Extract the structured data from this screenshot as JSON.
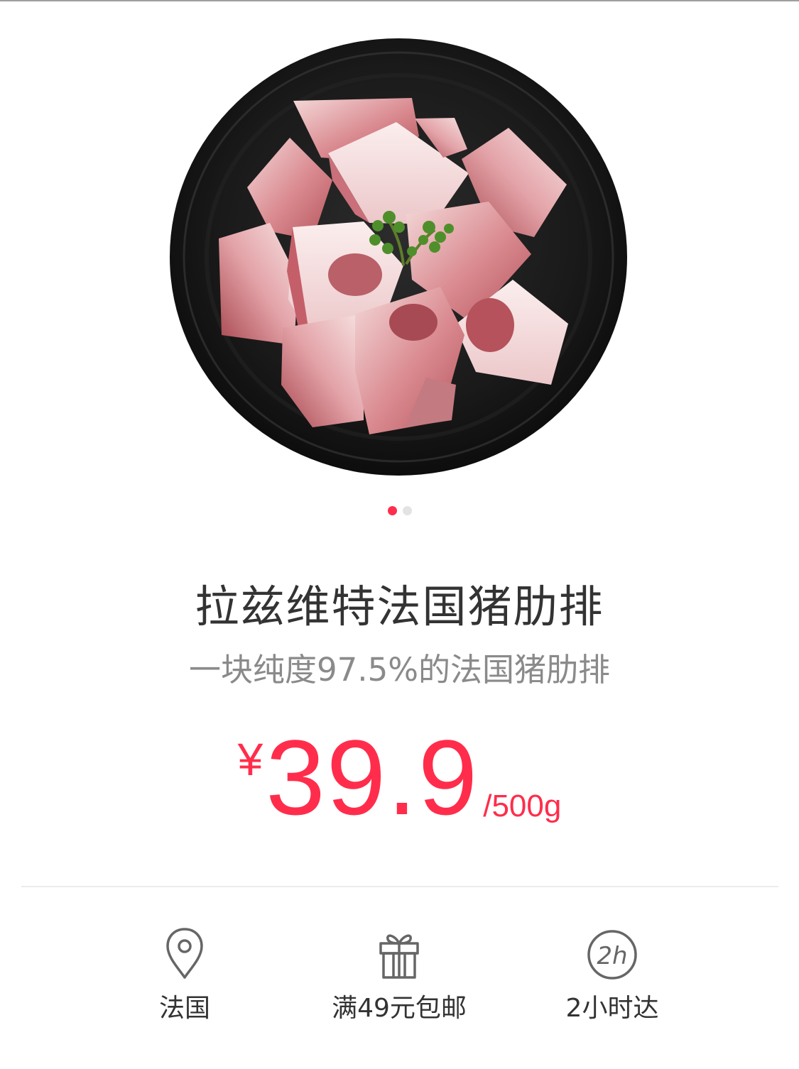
{
  "product": {
    "image_alt": "pork-ribs-on-black-plate",
    "title": "拉兹维特法国猪肋排",
    "subtitle": "一块纯度97.5%的法国猪肋排",
    "price": {
      "currency": "¥",
      "amount": "39.9",
      "unit": "/500g"
    }
  },
  "carousel": {
    "total": 2,
    "active_index": 0
  },
  "features": [
    {
      "icon": "location-pin-icon",
      "label": "法国"
    },
    {
      "icon": "gift-icon",
      "label": "满49元包邮"
    },
    {
      "icon": "two-hour-icon",
      "label": "2小时达",
      "icon_text": "2h"
    }
  ],
  "colors": {
    "accent": "#ff2d4b",
    "title": "#333333",
    "subtitle": "#8a8a8a",
    "icon": "#666666"
  }
}
